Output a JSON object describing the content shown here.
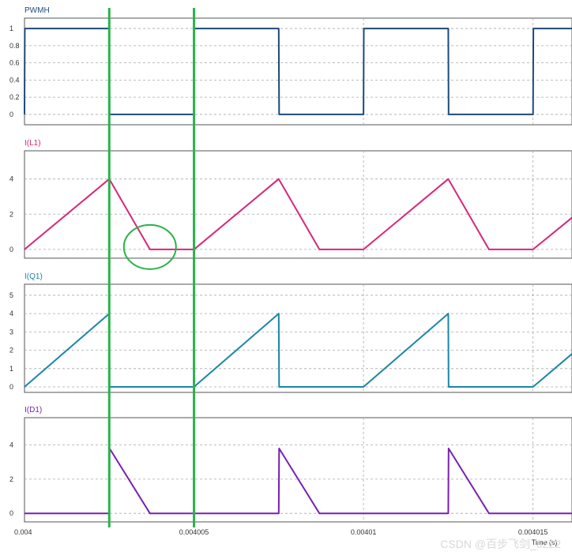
{
  "chart_data": [
    {
      "type": "line",
      "title": "PWMH",
      "color": "#1c4a7a",
      "ylim": [
        -0.12,
        1.12
      ],
      "y_ticks": [
        "1",
        "0.8",
        "0.6",
        "0.4",
        "0.2",
        "0"
      ],
      "y_tick_values": [
        1,
        0.8,
        0.6,
        0.4,
        0.2,
        0
      ],
      "grid": true,
      "x": [
        0.004,
        0.00400001,
        0.0040025,
        0.00400251,
        0.004005,
        0.00400501,
        0.0040075,
        0.00400751,
        0.00401,
        0.00401001,
        0.0040125,
        0.00401251,
        0.004015,
        0.00401501,
        0.00401615
      ],
      "y": [
        0,
        1,
        1,
        0,
        0,
        1,
        1,
        0,
        0,
        1,
        1,
        0,
        0,
        1,
        1
      ]
    },
    {
      "type": "line",
      "title": "I(L1)",
      "color": "#d6267d",
      "ylim": [
        -0.5,
        5.6
      ],
      "y_ticks": [
        "4",
        "2",
        "0"
      ],
      "y_tick_values": [
        4,
        2,
        0
      ],
      "grid": true,
      "x": [
        0.004,
        0.0040025,
        0.0040037,
        0.004005,
        0.0040075,
        0.0040087,
        0.00401,
        0.0040125,
        0.0040137,
        0.004015,
        0.00401615
      ],
      "y": [
        0,
        4,
        0,
        0,
        4,
        0,
        0,
        4,
        0,
        0,
        1.8
      ]
    },
    {
      "type": "line",
      "title": "I(Q1)",
      "color": "#1b86a6",
      "ylim": [
        -0.3,
        5.6
      ],
      "y_ticks": [
        "5",
        "4",
        "3",
        "2",
        "1",
        "0"
      ],
      "y_tick_values": [
        5,
        4,
        3,
        2,
        1,
        0
      ],
      "grid": true,
      "x": [
        0.004,
        0.0040025,
        0.00400251,
        0.004005,
        0.0040075,
        0.00400751,
        0.00401,
        0.0040125,
        0.00401251,
        0.004015,
        0.00401615
      ],
      "y": [
        0,
        4,
        0,
        0,
        4,
        0,
        0,
        4,
        0,
        0,
        1.8
      ]
    },
    {
      "type": "line",
      "title": "I(D1)",
      "color": "#7a1fb0",
      "ylim": [
        -0.5,
        5.6
      ],
      "y_ticks": [
        "4",
        "2",
        "0"
      ],
      "y_tick_values": [
        4,
        2,
        0
      ],
      "grid": true,
      "x": [
        0.004,
        0.0040025,
        0.00400251,
        0.0040037,
        0.004005,
        0.0040075,
        0.00400751,
        0.0040087,
        0.00401,
        0.0040125,
        0.00401251,
        0.0040137,
        0.00401615
      ],
      "y": [
        0,
        0,
        3.8,
        0,
        0,
        0,
        3.8,
        0,
        0,
        0,
        3.8,
        0,
        0
      ]
    }
  ],
  "x_axis": {
    "xlim": [
      0.004,
      0.00401615
    ],
    "ticks": [
      "0.004",
      "0.004005",
      "0.00401",
      "0.004015"
    ],
    "tick_values": [
      0.004,
      0.004005,
      0.00401,
      0.004015
    ],
    "label": "Time (s)"
  },
  "markers": {
    "color": "#2bb24c",
    "cursor_times": [
      0.0040025,
      0.004005
    ],
    "circle": {
      "x": 0.0040037,
      "y": 0
    }
  },
  "watermark": "CSDN @百步飞剑_0222"
}
